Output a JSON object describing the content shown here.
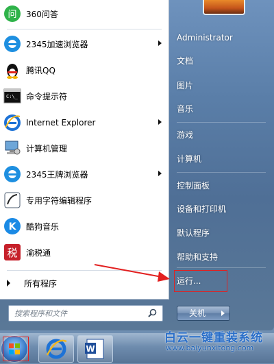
{
  "programs": [
    {
      "label": "360问答",
      "icon": "360-wenda-icon",
      "submenu": false
    },
    {
      "label": "2345加速浏览器",
      "icon": "2345-browser-icon",
      "submenu": true
    },
    {
      "label": "腾讯QQ",
      "icon": "qq-penguin-icon",
      "submenu": false
    },
    {
      "label": "命令提示符",
      "icon": "command-prompt-icon",
      "submenu": false
    },
    {
      "label": "Internet Explorer",
      "icon": "internet-explorer-icon",
      "submenu": true
    },
    {
      "label": "计算机管理",
      "icon": "computer-management-icon",
      "submenu": false
    },
    {
      "label": "2345王牌浏览器",
      "icon": "2345-browser-icon",
      "submenu": true
    },
    {
      "label": "专用字符编辑程序",
      "icon": "private-character-editor-icon",
      "submenu": false
    },
    {
      "label": "酷狗音乐",
      "icon": "kugou-music-icon",
      "submenu": false
    },
    {
      "label": "渝税通",
      "icon": "yushuitong-icon",
      "submenu": false
    }
  ],
  "all_programs": "所有程序",
  "search": {
    "placeholder": "搜索程序和文件"
  },
  "right": {
    "user": "Administrator",
    "documents": "文档",
    "pictures": "图片",
    "music": "音乐",
    "games": "游戏",
    "computer": "计算机",
    "control_panel": "控制面板",
    "devices": "设备和打印机",
    "default_programs": "默认程序",
    "help": "帮助和支持",
    "run": "运行..."
  },
  "shutdown": "关机",
  "watermark": {
    "title": "白云一键重装系统",
    "url": "www.baiyunxitong.com"
  },
  "colors": {
    "highlight": "#e22020",
    "panel": "#ffffff",
    "glass": "#5a7ea8"
  }
}
